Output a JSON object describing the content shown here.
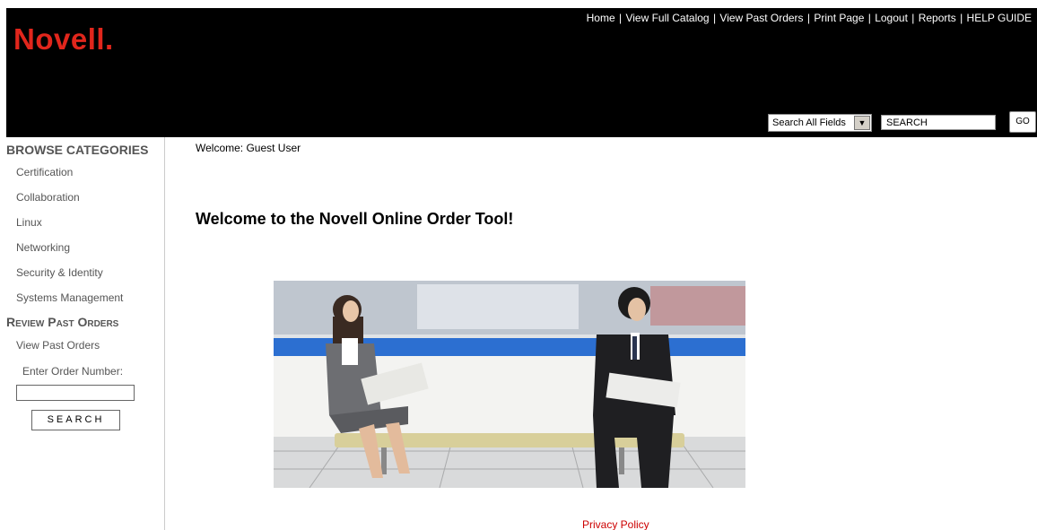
{
  "brand": {
    "logo_text": "Novell."
  },
  "topnav": {
    "items": [
      "Home",
      "View Full Catalog",
      "View Past Orders",
      "Print Page",
      "Logout",
      "Reports",
      "HELP GUIDE"
    ]
  },
  "search": {
    "field_select": "Search All Fields",
    "input_value": "SEARCH",
    "go_label": "GO"
  },
  "sidebar": {
    "browse_title": "BROWSE CATEGORIES",
    "categories": [
      "Certification",
      "Collaboration",
      "Linux",
      "Networking",
      "Security & Identity",
      "Systems Management"
    ],
    "review_title": "Review Past Orders",
    "view_past_orders": "View Past Orders",
    "order_number_label": "Enter Order Number:",
    "order_search_label": "SEARCH"
  },
  "main": {
    "welcome_user": "Welcome: Guest User",
    "title": "Welcome to the Novell Online Order Tool!",
    "hero_image": "commuters-reading-newspapers-photo"
  },
  "footer": {
    "privacy": "Privacy Policy"
  },
  "colors": {
    "header_bg": "#000000",
    "logo": "#e1261c",
    "privacy_link": "#cc0000",
    "sidebar_text": "#555555"
  }
}
